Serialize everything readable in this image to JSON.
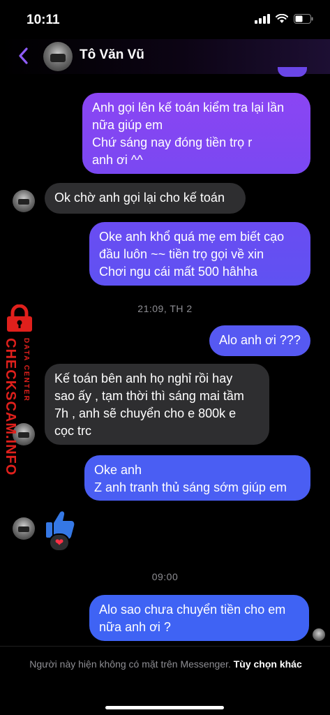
{
  "status_bar": {
    "time": "10:11"
  },
  "header": {
    "contact_name": "Tô Văn Vũ"
  },
  "messages": [
    {
      "side": "out",
      "text": "Anh gọi lên kế toán kiểm tra lại lần\nnữa giúp em\nChứ sáng nay đóng tiền trọ r\nanh ơi ^^"
    },
    {
      "side": "in",
      "text": "Ok chờ anh gọi lại cho kế toán"
    },
    {
      "side": "out",
      "text": "Oke anh khổ quá mẹ em biết cạo\nđầu luôn ~~ tiền trọ gọi về xin\nChơi ngu cái mất 500 hâhha"
    },
    {
      "side": "out",
      "text": "Alo anh ơi ???"
    },
    {
      "side": "in",
      "text": "Kế toán bên anh họ nghỉ rồi hay\nsao ấy , tạm thời thì sáng mai tầm\n7h , anh sẽ chuyển cho e 800k e\ncọc trc"
    },
    {
      "side": "out",
      "text": "Oke anh\nZ anh tranh thủ sáng sớm giúp em"
    },
    {
      "side": "out",
      "text": "Alo sao chưa chuyển tiền cho em\nnữa anh ơi ?"
    }
  ],
  "timestamps": [
    "21:09, TH 2",
    "09:00"
  ],
  "reaction": "❤",
  "watermark": {
    "main": "CHECKSCAM.INFO",
    "sub": "DATA CENTER"
  },
  "footer": {
    "notice": "Người này hiện không có mặt trên Messenger.",
    "link": "Tùy chọn khác"
  },
  "colors": {
    "bubble_purple": "#7a43f2",
    "bubble_blue": "#3f63f4",
    "incoming": "#2e2e30",
    "accent": "#8e5cf6",
    "watermark": "#e0201c"
  }
}
